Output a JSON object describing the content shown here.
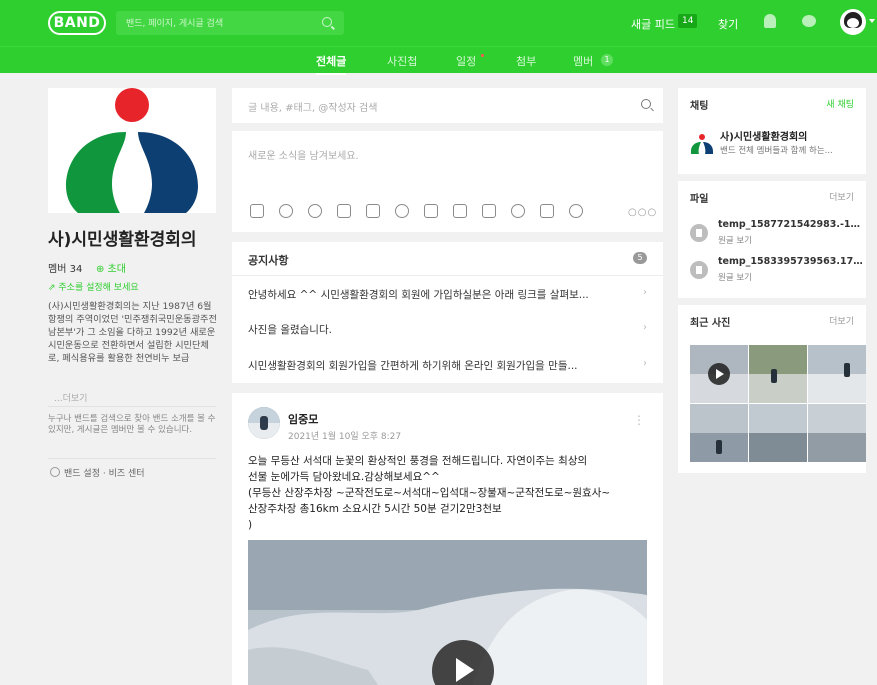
{
  "topbar": {
    "logo": "BAND",
    "search_placeholder": "밴드, 페이지, 게시글 검색",
    "new_feed_label": "새글 피드",
    "new_feed_count": "14",
    "find_label": "찾기",
    "icons": [
      "search-icon",
      "bell-icon",
      "chat-icon",
      "avatar"
    ]
  },
  "tabs": {
    "all": "전체글",
    "photos": "사진첩",
    "schedule": "일정",
    "attach": "첨부",
    "members": "멤버",
    "members_badge": "1"
  },
  "band": {
    "title": "사)시민생활환경회의",
    "member_count": "멤버 34",
    "invite": "⊕ 초대",
    "address_hint": "주소를 설정해 보세요",
    "description": "(사)시민생활환경회의는 지난 1987년 6월 항쟁의 주역이었던 '민주쟁취국민운동광주전남본부'가 그 소임을 다하고 1992년 새로운 시민운동으로 전환하면서 설립한 시민단체로, 폐식용유를 활용한 천연비누 보급",
    "more": "...더보기",
    "info": "누구나 밴드를 검색으로 찾아 밴드 소개를 볼 수 있지만, 게시글은 멤버만 볼 수 있습니다.",
    "settings": "밴드 설정 · 비즈 센터"
  },
  "main": {
    "post_search_placeholder": "글 내용, #태그, @작성자 검색",
    "composer_placeholder": "새로운 소식을 남겨보세요.",
    "notice": {
      "title": "공지사항",
      "count": "5",
      "items": [
        "안녕하세요 ^^ 시민생활환경회의 회원에 가입하실분은 아래 링크를 살펴보...",
        "사진을 올렸습니다.",
        "시민생활환경회의 회원가입을 간편하게 하기위해 온라인 회원가입을 만들..."
      ]
    },
    "post": {
      "author": "임중모",
      "date": "2021년 1월 10일 오후 8:27",
      "lines": [
        "오늘 무등산 서석대 눈꽃의 환상적인 풍경을 전해드립니다. 자연이주는 최상의",
        "선물 눈에가득 담아왔네요.감상해보세요^^",
        "(무등산 산장주차장 ~군작전도로~서석대~입석대~장불재~군작전도로~원효사~",
        "산장주차장   총16km  소요시간 5시간 50분 걷기2만3천보",
        ")"
      ]
    }
  },
  "sidebar": {
    "chat": {
      "title": "채팅",
      "new_chat": "새 채팅",
      "room_name": "사)시민생활환경회의",
      "room_sub": "밴드 전체 멤버들과 함께 하는..."
    },
    "files": {
      "title": "파일",
      "more": "더보기",
      "items": [
        {
          "name": "temp_1587721542983.-1768...",
          "sub": "원글 보기"
        },
        {
          "name": "temp_1583395739563.1725...",
          "sub": "원글 보기"
        }
      ]
    },
    "photos": {
      "title": "최근 사진",
      "more": "더보기"
    }
  },
  "colors": {
    "brand_green": "#2fcf2f",
    "logo_red": "#e8242b",
    "logo_green": "#10973e",
    "logo_navy": "#0d3f72"
  }
}
